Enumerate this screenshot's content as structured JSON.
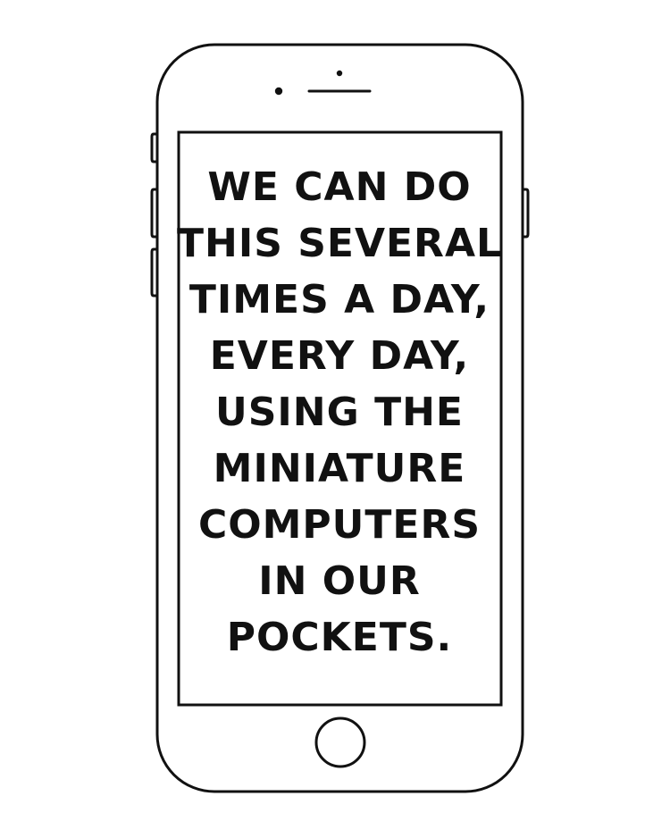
{
  "colors": {
    "ink": "#111111",
    "background": "#ffffff"
  },
  "screen": {
    "lines": [
      "WE CAN DO",
      "THIS SEVERAL",
      "TIMES A DAY,",
      "EVERY DAY,",
      "USING THE",
      "MINIATURE",
      "COMPUTERS",
      "IN OUR",
      "POCKETS."
    ]
  }
}
